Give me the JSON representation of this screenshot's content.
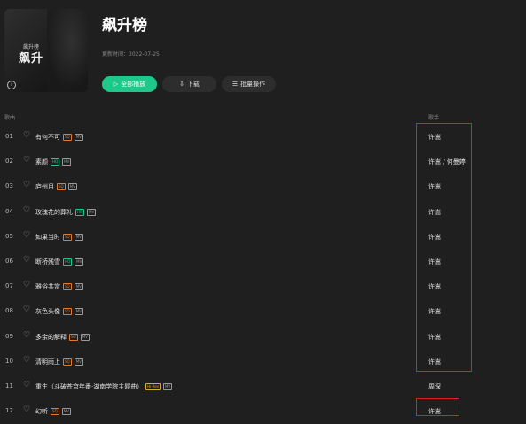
{
  "playlist": {
    "cover_tiny": "飙升榜",
    "cover_big": "飙升",
    "title": "飙升榜",
    "update": "更新时间：2022-07-25"
  },
  "actions": {
    "play_all": "全部播放",
    "download": "下载",
    "batch": "批量操作"
  },
  "columns": {
    "song": "歌曲",
    "artist": "歌手"
  },
  "colors": {
    "accent": "#1ec88a",
    "highlight": "#e02020"
  },
  "songs": [
    {
      "num": "01",
      "title": "有何不可",
      "tags": [
        "SQ",
        "MV"
      ],
      "artist": "许嵩"
    },
    {
      "num": "02",
      "title": "素颜",
      "tags": [
        "HQ",
        "MV"
      ],
      "artist": "许嵩 / 何曼婷"
    },
    {
      "num": "03",
      "title": "庐州月",
      "tags": [
        "SQ",
        "MV"
      ],
      "artist": "许嵩"
    },
    {
      "num": "04",
      "title": "玫瑰花的葬礼",
      "tags": [
        "HQ",
        "MV"
      ],
      "artist": "许嵩"
    },
    {
      "num": "05",
      "title": "如果当时",
      "tags": [
        "SQ",
        "MV"
      ],
      "artist": "许嵩"
    },
    {
      "num": "06",
      "title": "断桥残雪",
      "tags": [
        "HQ",
        "MV"
      ],
      "artist": "许嵩"
    },
    {
      "num": "07",
      "title": "雅俗共赏",
      "tags": [
        "SQ",
        "MV"
      ],
      "artist": "许嵩"
    },
    {
      "num": "08",
      "title": "灰色头像",
      "tags": [
        "SQ",
        "MV"
      ],
      "artist": "许嵩"
    },
    {
      "num": "09",
      "title": "多余的解释",
      "tags": [
        "SQ",
        "MV"
      ],
      "artist": "许嵩"
    },
    {
      "num": "10",
      "title": "清明雨上",
      "tags": [
        "SQ",
        "MV"
      ],
      "artist": "许嵩"
    },
    {
      "num": "11",
      "title": "重生（斗破苍穹年番·湖南学院主题曲）",
      "tags": [
        "Hi-Res",
        "MV"
      ],
      "artist": "周深"
    },
    {
      "num": "12",
      "title": "幻听",
      "tags": [
        "SQ",
        "MV"
      ],
      "artist": "许嵩"
    }
  ]
}
